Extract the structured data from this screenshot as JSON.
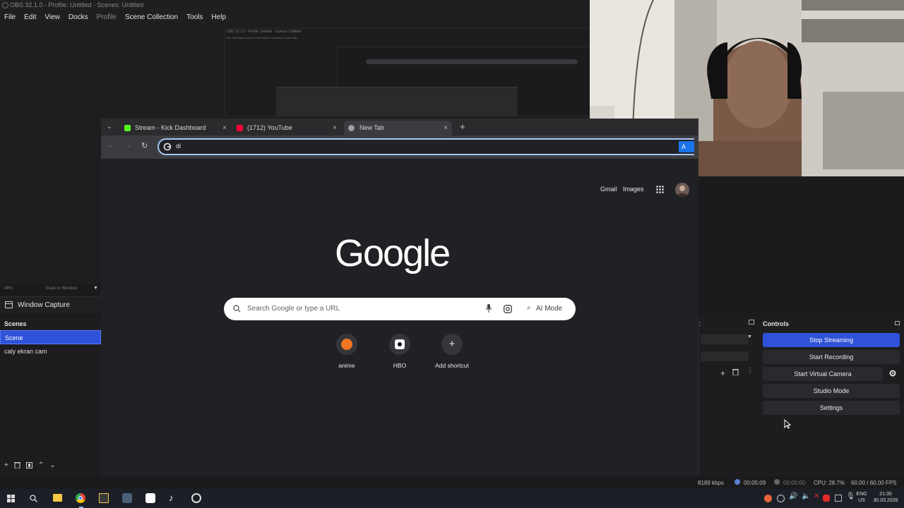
{
  "obs": {
    "title": "OBS 32.1.0 - Profile: Untitled - Scenes: Untitled",
    "menu": [
      "File",
      "Edit",
      "View",
      "Docks",
      "Profile",
      "Scene Collection",
      "Tools",
      "Help"
    ],
    "zoom_value": "48%",
    "zoom_mode": "Scale to Window",
    "source_name": "Window Capture",
    "scenes_header": "Scenes",
    "scenes": [
      "Scene",
      "caly ekran cam"
    ],
    "controls_header": "Controls",
    "controls": {
      "stop_streaming": "Stop Streaming",
      "start_recording": "Start Recording",
      "start_virtual_camera": "Start Virtual Camera",
      "studio_mode": "Studio Mode",
      "settings": "Settings"
    },
    "status": {
      "bitrate": "8189 kbps",
      "stream_time": "00:05:09",
      "record_time": "00:00:00",
      "cpu": "CPU: 28.7%",
      "fps": "60.00 / 60.00 FPS"
    },
    "nested_title": "OBS 32.1.0 - Profile: Untitled - Scenes: Untitled"
  },
  "chrome": {
    "tabs": [
      {
        "label": "Stream - Kick Dashboard",
        "favicon_color": "#53fc18"
      },
      {
        "label": "(1712) YouTube",
        "favicon_color": "#ff0033"
      },
      {
        "label": "New Tab",
        "favicon_color": "#9aa0a6"
      }
    ],
    "omnibox_value": "di",
    "ai_label": "A",
    "links": {
      "gmail": "Gmail",
      "images": "Images"
    },
    "logo": "Google",
    "search_placeholder": "Search Google or type a URL",
    "ai_mode": "AI Mode",
    "shortcuts": [
      {
        "label": "anime",
        "icon": "crunchyroll-icon"
      },
      {
        "label": "HBO",
        "icon": "hbo-icon"
      },
      {
        "label": "Add shortcut",
        "icon": "plus-icon"
      }
    ]
  },
  "taskbar": {
    "lang1": "ENG",
    "lang2": "US",
    "time": "21:35",
    "date": "30.03.2026"
  },
  "colors": {
    "accent": "#2f52d8",
    "omnibox_border": "#a8c7fa",
    "kick": "#53fc18",
    "youtube": "#ff0033",
    "crunchyroll": "#f47521"
  }
}
